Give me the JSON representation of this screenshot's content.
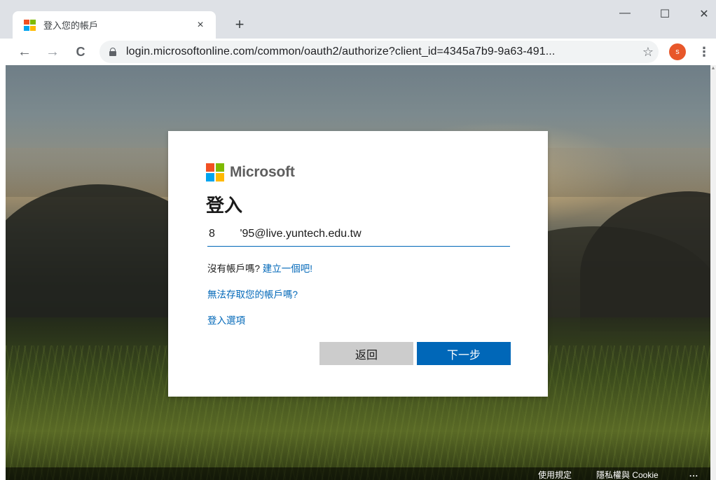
{
  "browser": {
    "tab_title": "登入您的帳戶",
    "tab_close": "×",
    "new_tab": "+",
    "minimize": "—",
    "maximize": "☐",
    "close": "✕",
    "back": "←",
    "forward": "→",
    "reload": "C",
    "url": "login.microsoftonline.com/common/oauth2/authorize?client_id=4345a7b9-9a63-491...",
    "star": "☆",
    "profile_initial": "s",
    "menu": "⋮"
  },
  "logo_colors": [
    "#f25022",
    "#7fba00",
    "#00a4ef",
    "#ffb900"
  ],
  "card": {
    "brand": "Microsoft",
    "title": "登入",
    "email_value": "8        '95@live.yuntech.edu.tw",
    "no_account_text": "沒有帳戶嗎?",
    "create_link": "建立一個吧!",
    "cant_access_link": "無法存取您的帳戶嗎?",
    "signin_options_link": "登入選項",
    "back_button": "返回",
    "next_button": "下一步"
  },
  "footer": {
    "terms": "使用規定",
    "privacy": "隱私權與 Cookie",
    "more": "..."
  },
  "colors": {
    "accent": "#0067b8",
    "back_button_bg": "#cccccc",
    "profile_avatar": "#e8572a"
  }
}
